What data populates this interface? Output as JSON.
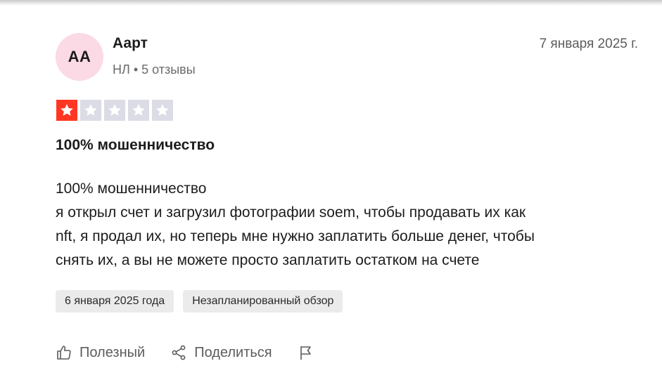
{
  "reviewer": {
    "initials": "АА",
    "name": "Аарт",
    "country": "НЛ",
    "review_count": "5 отзывы",
    "avatar_color": "#fbd9e5"
  },
  "review": {
    "date": "7 января 2025 г.",
    "rating": 1,
    "max_rating": 5,
    "title": "100% мошенничество",
    "body_lines": [
      "100% мошенничество",
      "я открыл счет и загрузил фотографии soem, чтобы продавать их как",
      "nft, я продал их, но теперь мне нужно заплатить больше денег, чтобы",
      "снять их, а вы не можете просто заплатить остатком на счете"
    ],
    "experience_date": "6 января 2025 года",
    "review_type": "Незапланированный обзор"
  },
  "actions": {
    "useful_label": "Полезный",
    "share_label": "Поделиться",
    "useful_icon": "thumbs-up-icon",
    "share_icon": "share-icon",
    "report_icon": "flag-icon"
  },
  "colors": {
    "star_filled": "#ff3722",
    "star_empty": "#dcdce6",
    "tag_bg": "#ebebeb"
  }
}
